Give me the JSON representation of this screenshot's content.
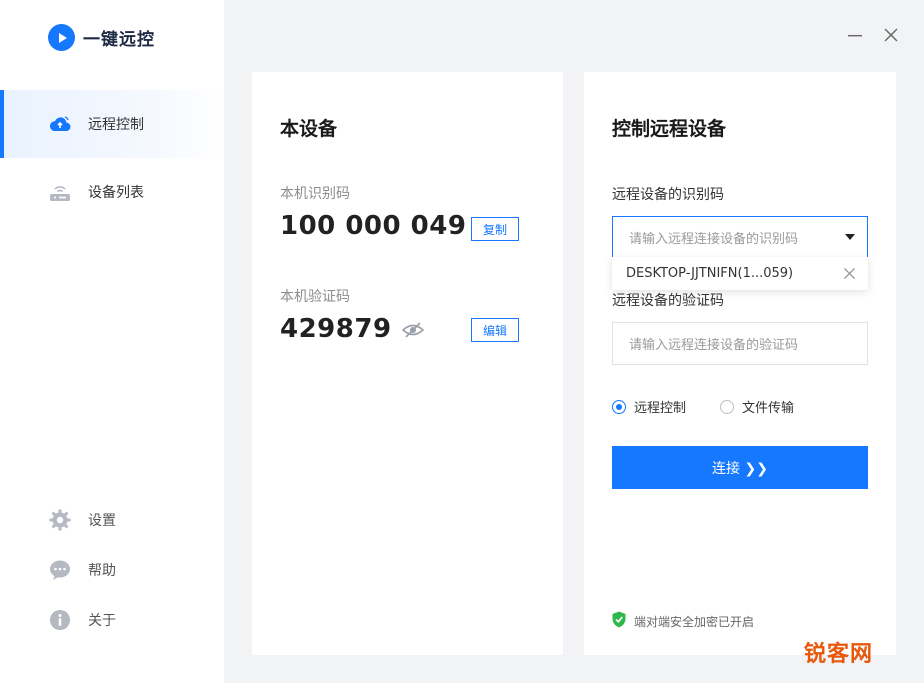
{
  "app": {
    "title": "一键远控"
  },
  "sidebar": {
    "items": [
      {
        "label": "远程控制",
        "icon": "cloud-remote-icon",
        "active": true
      },
      {
        "label": "设备列表",
        "icon": "router-icon",
        "active": false
      }
    ],
    "bottom": [
      {
        "label": "设置",
        "icon": "gear-icon"
      },
      {
        "label": "帮助",
        "icon": "chat-help-icon"
      },
      {
        "label": "关于",
        "icon": "info-icon"
      }
    ]
  },
  "window": {
    "minimize_icon": "minimize-icon",
    "close_icon": "close-icon"
  },
  "local": {
    "title": "本设备",
    "id_label": "本机识别码",
    "id_value": "100 000 049",
    "copy_label": "复制",
    "code_label": "本机验证码",
    "code_value": "429879",
    "edit_label": "编辑",
    "eye_icon": "eye-off-icon"
  },
  "remote": {
    "title": "控制远程设备",
    "id_label": "远程设备的识别码",
    "id_placeholder": "请输入远程连接设备的识别码",
    "dropdown_item": "DESKTOP-JJTNIFN(1...059)",
    "code_label": "远程设备的验证码",
    "code_placeholder": "请输入远程连接设备的验证码",
    "modes": [
      {
        "label": "远程控制",
        "checked": true
      },
      {
        "label": "文件传输",
        "checked": false
      }
    ],
    "connect_label": "连接 ❯❯",
    "secure_text": "端对端安全加密已开启"
  },
  "watermark": "锐客网",
  "colors": {
    "accent": "#1677ff",
    "secure": "#2fb84a",
    "watermark": "#e8580c"
  }
}
